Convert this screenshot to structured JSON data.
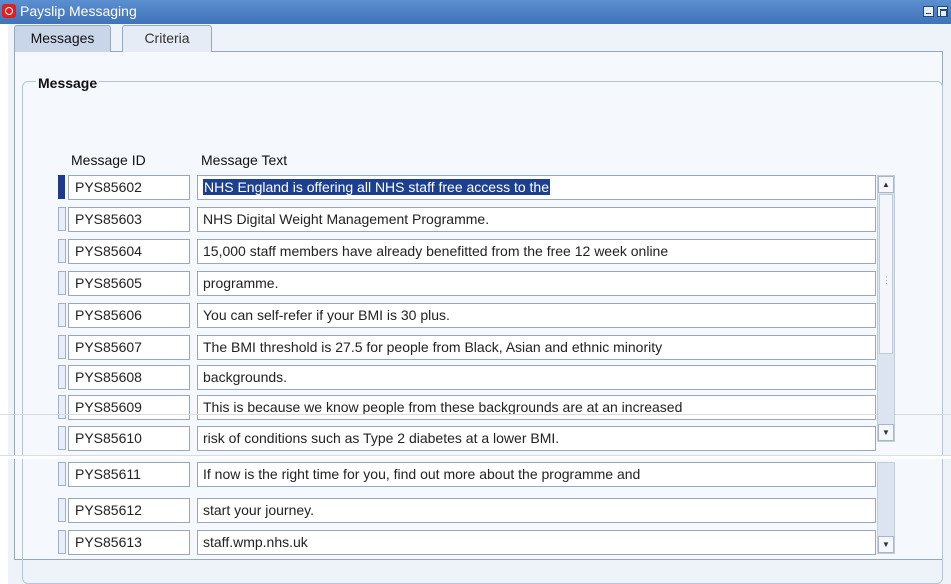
{
  "window": {
    "title": "Payslip Messaging"
  },
  "tabs": [
    {
      "label": "Messages",
      "active": true
    },
    {
      "label": "Criteria",
      "active": false
    }
  ],
  "group": {
    "title": "Message"
  },
  "columns": {
    "message_id": "Message ID",
    "message_text": "Message Text"
  },
  "rows": [
    {
      "id": "PYS85602",
      "text": "NHS England is offering all NHS staff free access to the"
    },
    {
      "id": "PYS85603",
      "text": "NHS Digital Weight Management Programme."
    },
    {
      "id": "PYS85604",
      "text": "15,000 staff members have already benefitted from the free 12 week online"
    },
    {
      "id": "PYS85605",
      "text": "programme."
    },
    {
      "id": "PYS85606",
      "text": "You can self-refer if your BMI is 30 plus."
    },
    {
      "id": "PYS85607",
      "text": "The BMI threshold is 27.5 for people from Black, Asian and ethnic minority"
    },
    {
      "id": "PYS85608",
      "text": "backgrounds."
    },
    {
      "id": "PYS85609",
      "text": "This is because we know people from these backgrounds are at an increased"
    },
    {
      "id": "PYS85610",
      "text": "risk of conditions such as Type 2 diabetes at a lower BMI."
    },
    {
      "id": "PYS85611",
      "text": "If now is the right time for you, find out more about the programme and"
    },
    {
      "id": "PYS85612",
      "text": "start your journey."
    },
    {
      "id": "PYS85613",
      "text": "staff.wmp.nhs.uk"
    }
  ],
  "colors": {
    "titlebar": "#4a7fc4",
    "selection": "#1c3f8f",
    "record_indicator": "#1f3a8a",
    "window_bg": "#eef3fa"
  },
  "icons": [
    "oracle-logo-icon",
    "minimize-icon",
    "maximize-icon",
    "scroll-up-icon",
    "scroll-down-icon"
  ]
}
